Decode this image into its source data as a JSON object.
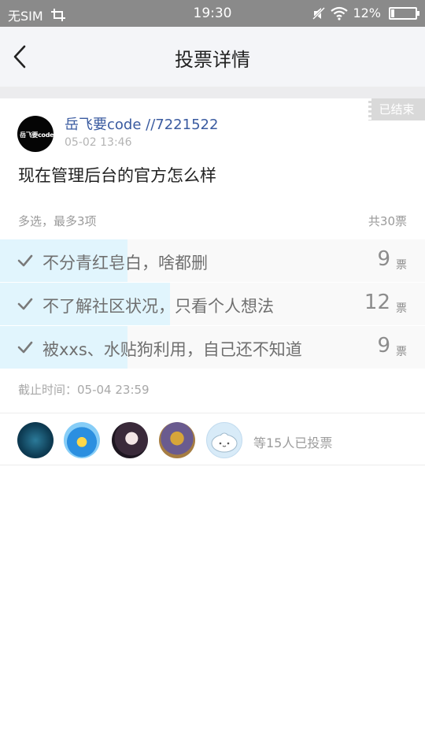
{
  "status_bar": {
    "carrier": "无SIM",
    "time": "19:30",
    "battery": "12%",
    "battery_level": 0.12
  },
  "header": {
    "title": "投票详情",
    "back_icon": "chevron-left-icon"
  },
  "post": {
    "status_tag": "已结束",
    "avatar_text": "岳飞要code",
    "author": "岳飞要code //7221522",
    "date": "05-02 13:46",
    "question": "现在管理后台的官方怎么样"
  },
  "vote": {
    "type_label": "多选，最多3项",
    "total_label": "共30票",
    "total_votes": 30,
    "accent_color": "#e1f5fd",
    "options": [
      {
        "text": "不分青红皂白，啥都删",
        "count": "9",
        "unit": "票",
        "votes": 9
      },
      {
        "text": "不了解社区状况，只看个人想法",
        "count": "12",
        "unit": "票",
        "votes": 12
      },
      {
        "text": "被xxs、水贴狗利用，自己还不知道",
        "count": "9",
        "unit": "票",
        "votes": 9
      }
    ],
    "deadline": "截止时间：05-04 23:59"
  },
  "voters": {
    "summary": "等15人已投票"
  }
}
